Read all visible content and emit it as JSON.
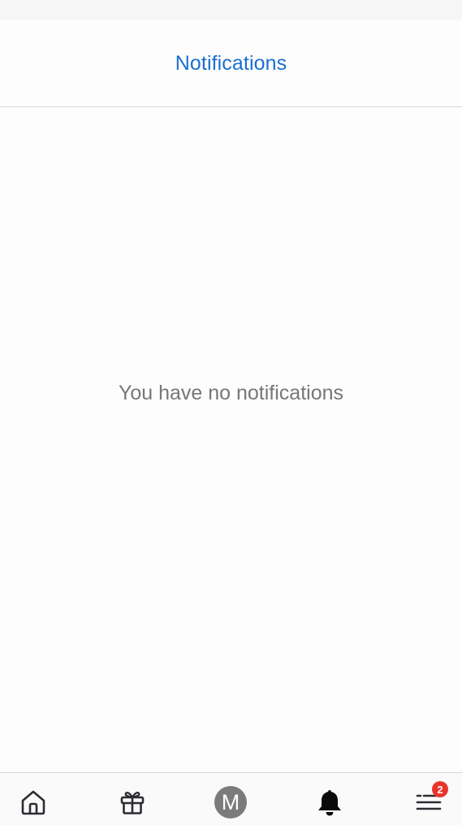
{
  "header": {
    "title": "Notifications"
  },
  "main": {
    "empty_message": "You have no notifications"
  },
  "tabbar": {
    "items": [
      {
        "icon": "home-icon",
        "active": false
      },
      {
        "icon": "gift-icon",
        "active": false
      },
      {
        "icon": "avatar",
        "avatar_initial": "M",
        "active": false
      },
      {
        "icon": "bell-icon",
        "active": true
      },
      {
        "icon": "menu-icon",
        "active": false,
        "badge_count": "2"
      }
    ]
  },
  "colors": {
    "accent": "#1a6fd0",
    "muted": "#777777",
    "icon": "#2b2d33",
    "badge": "#e8352a"
  }
}
